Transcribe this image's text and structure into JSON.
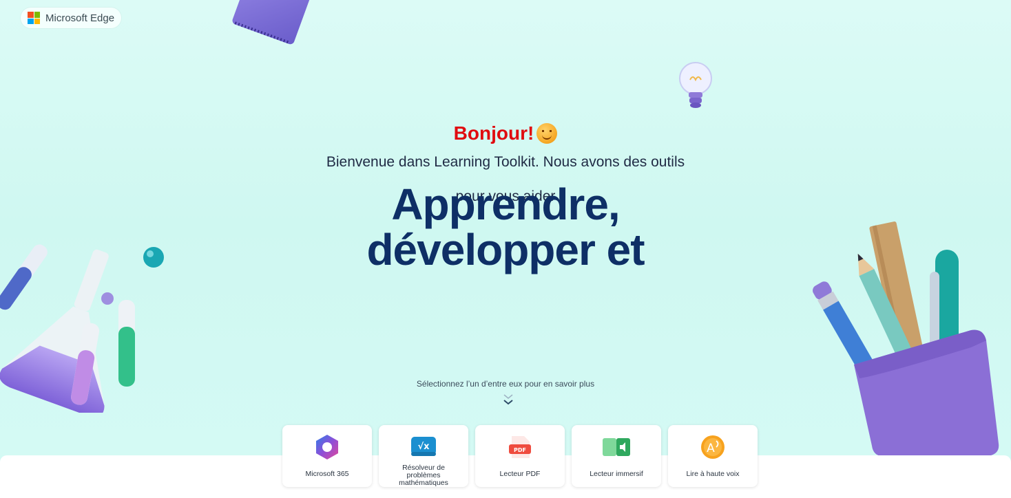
{
  "badge": {
    "label": "Microsoft Edge",
    "logo_colors": [
      "#f25022",
      "#7fba00",
      "#00a4ef",
      "#ffb900"
    ]
  },
  "greeting": {
    "hello": "Bonjour!",
    "emoji": "smiling-face-icon"
  },
  "welcome": {
    "line1": "Bienvenue dans Learning Toolkit. Nous avons des outils",
    "line2": "pour vous aider"
  },
  "headline": {
    "line1": "Apprendre,",
    "line2": "développer et"
  },
  "hint": {
    "text": "Sélectionnez l’un d’entre eux pour en savoir plus"
  },
  "tools": [
    {
      "label": "Microsoft 365",
      "icon": "microsoft-365-icon"
    },
    {
      "label": "Résolveur de problèmes mathématiques",
      "icon": "math-solver-icon"
    },
    {
      "label": "Lecteur PDF",
      "icon": "pdf-reader-icon"
    },
    {
      "label": "Lecteur immersif",
      "icon": "immersive-reader-icon"
    },
    {
      "label": "Lire à haute voix",
      "icon": "read-aloud-icon"
    }
  ],
  "colors": {
    "accent_red": "#e00c10",
    "headline_blue": "#0e2f66",
    "background": "#d5faf5"
  }
}
